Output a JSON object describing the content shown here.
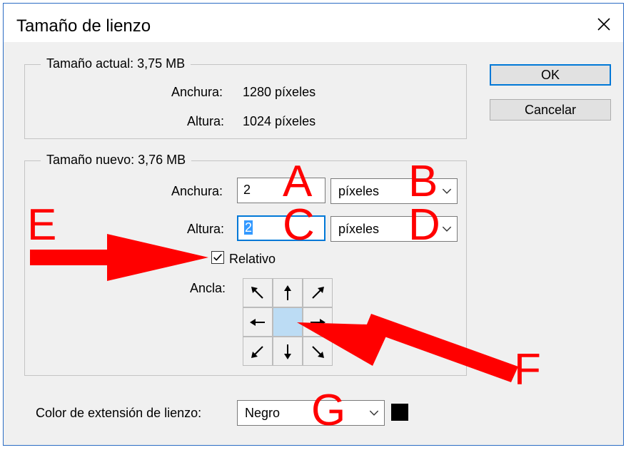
{
  "dialog": {
    "title": "Tamaño de lienzo"
  },
  "current_size": {
    "legend": "Tamaño actual: 3,75 MB",
    "width_label": "Anchura:",
    "width_value": "1280 píxeles",
    "height_label": "Altura:",
    "height_value": "1024 píxeles"
  },
  "new_size": {
    "legend": "Tamaño nuevo: 3,76 MB",
    "width_label": "Anchura:",
    "width_value": "2",
    "width_unit": "píxeles",
    "height_label": "Altura:",
    "height_value": "2",
    "height_unit": "píxeles",
    "relative_label": "Relativo",
    "relative_checked": true,
    "anchor_label": "Ancla:"
  },
  "buttons": {
    "ok": "OK",
    "cancel": "Cancelar"
  },
  "extension": {
    "label": "Color de extensión de lienzo:",
    "value": "Negro",
    "swatch_color": "#000000"
  },
  "annotations": {
    "a": "A",
    "b": "B",
    "c": "C",
    "d": "D",
    "e": "E",
    "f": "F",
    "g": "G",
    "color": "#ff0000"
  },
  "icons": [
    "close-icon",
    "chevron-down-icon",
    "checkmark-icon",
    "arrow-up-left-icon",
    "arrow-up-icon",
    "arrow-up-right-icon",
    "arrow-left-icon",
    "arrow-right-icon",
    "arrow-down-left-icon",
    "arrow-down-icon",
    "arrow-down-right-icon"
  ]
}
